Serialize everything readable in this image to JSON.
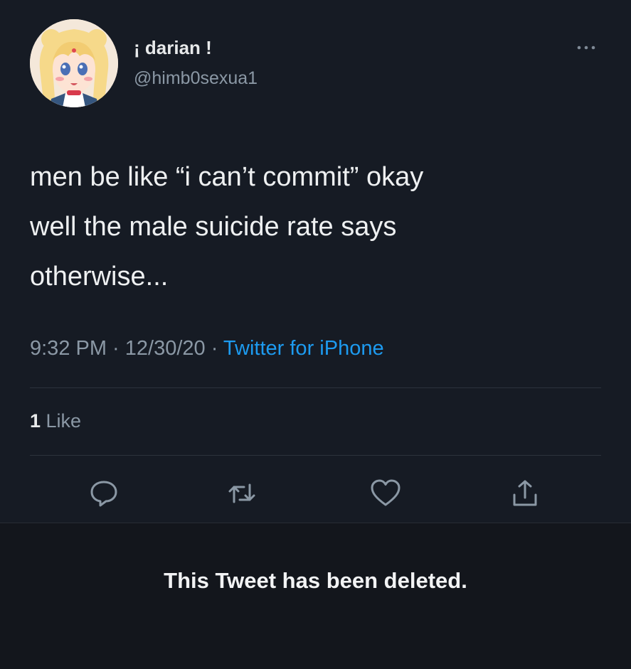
{
  "author": {
    "display_name": "¡ darian !",
    "handle": "@himb0sexua1"
  },
  "tweet": {
    "text_lines": [
      "men be like “i can’t commit” okay",
      "well the male suicide rate says",
      "otherwise..."
    ],
    "time": "9:32 PM",
    "date": "12/30/20",
    "separator": " · ",
    "source": "Twitter for iPhone"
  },
  "engagement": {
    "like_count": "1",
    "like_label": " Like"
  },
  "actions": {
    "reply_icon": "reply-icon",
    "retweet_icon": "retweet-icon",
    "like_icon": "heart-icon",
    "share_icon": "share-icon"
  },
  "deleted_notice": "This Tweet has been deleted.",
  "colors": {
    "background": "#161b24",
    "text": "#e7e9ea",
    "secondary_text": "#8b98a5",
    "link": "#1d9bf0"
  }
}
